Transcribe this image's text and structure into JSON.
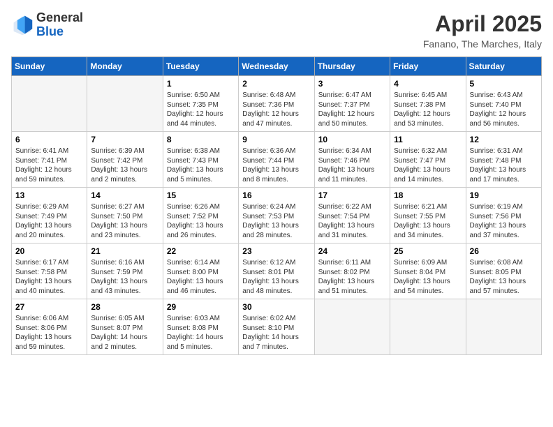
{
  "header": {
    "logo_line1": "General",
    "logo_line2": "Blue",
    "title": "April 2025",
    "subtitle": "Fanano, The Marches, Italy"
  },
  "days_of_week": [
    "Sunday",
    "Monday",
    "Tuesday",
    "Wednesday",
    "Thursday",
    "Friday",
    "Saturday"
  ],
  "weeks": [
    [
      {
        "num": "",
        "sunrise": "",
        "sunset": "",
        "daylight": ""
      },
      {
        "num": "",
        "sunrise": "",
        "sunset": "",
        "daylight": ""
      },
      {
        "num": "1",
        "sunrise": "Sunrise: 6:50 AM",
        "sunset": "Sunset: 7:35 PM",
        "daylight": "Daylight: 12 hours and 44 minutes."
      },
      {
        "num": "2",
        "sunrise": "Sunrise: 6:48 AM",
        "sunset": "Sunset: 7:36 PM",
        "daylight": "Daylight: 12 hours and 47 minutes."
      },
      {
        "num": "3",
        "sunrise": "Sunrise: 6:47 AM",
        "sunset": "Sunset: 7:37 PM",
        "daylight": "Daylight: 12 hours and 50 minutes."
      },
      {
        "num": "4",
        "sunrise": "Sunrise: 6:45 AM",
        "sunset": "Sunset: 7:38 PM",
        "daylight": "Daylight: 12 hours and 53 minutes."
      },
      {
        "num": "5",
        "sunrise": "Sunrise: 6:43 AM",
        "sunset": "Sunset: 7:40 PM",
        "daylight": "Daylight: 12 hours and 56 minutes."
      }
    ],
    [
      {
        "num": "6",
        "sunrise": "Sunrise: 6:41 AM",
        "sunset": "Sunset: 7:41 PM",
        "daylight": "Daylight: 12 hours and 59 minutes."
      },
      {
        "num": "7",
        "sunrise": "Sunrise: 6:39 AM",
        "sunset": "Sunset: 7:42 PM",
        "daylight": "Daylight: 13 hours and 2 minutes."
      },
      {
        "num": "8",
        "sunrise": "Sunrise: 6:38 AM",
        "sunset": "Sunset: 7:43 PM",
        "daylight": "Daylight: 13 hours and 5 minutes."
      },
      {
        "num": "9",
        "sunrise": "Sunrise: 6:36 AM",
        "sunset": "Sunset: 7:44 PM",
        "daylight": "Daylight: 13 hours and 8 minutes."
      },
      {
        "num": "10",
        "sunrise": "Sunrise: 6:34 AM",
        "sunset": "Sunset: 7:46 PM",
        "daylight": "Daylight: 13 hours and 11 minutes."
      },
      {
        "num": "11",
        "sunrise": "Sunrise: 6:32 AM",
        "sunset": "Sunset: 7:47 PM",
        "daylight": "Daylight: 13 hours and 14 minutes."
      },
      {
        "num": "12",
        "sunrise": "Sunrise: 6:31 AM",
        "sunset": "Sunset: 7:48 PM",
        "daylight": "Daylight: 13 hours and 17 minutes."
      }
    ],
    [
      {
        "num": "13",
        "sunrise": "Sunrise: 6:29 AM",
        "sunset": "Sunset: 7:49 PM",
        "daylight": "Daylight: 13 hours and 20 minutes."
      },
      {
        "num": "14",
        "sunrise": "Sunrise: 6:27 AM",
        "sunset": "Sunset: 7:50 PM",
        "daylight": "Daylight: 13 hours and 23 minutes."
      },
      {
        "num": "15",
        "sunrise": "Sunrise: 6:26 AM",
        "sunset": "Sunset: 7:52 PM",
        "daylight": "Daylight: 13 hours and 26 minutes."
      },
      {
        "num": "16",
        "sunrise": "Sunrise: 6:24 AM",
        "sunset": "Sunset: 7:53 PM",
        "daylight": "Daylight: 13 hours and 28 minutes."
      },
      {
        "num": "17",
        "sunrise": "Sunrise: 6:22 AM",
        "sunset": "Sunset: 7:54 PM",
        "daylight": "Daylight: 13 hours and 31 minutes."
      },
      {
        "num": "18",
        "sunrise": "Sunrise: 6:21 AM",
        "sunset": "Sunset: 7:55 PM",
        "daylight": "Daylight: 13 hours and 34 minutes."
      },
      {
        "num": "19",
        "sunrise": "Sunrise: 6:19 AM",
        "sunset": "Sunset: 7:56 PM",
        "daylight": "Daylight: 13 hours and 37 minutes."
      }
    ],
    [
      {
        "num": "20",
        "sunrise": "Sunrise: 6:17 AM",
        "sunset": "Sunset: 7:58 PM",
        "daylight": "Daylight: 13 hours and 40 minutes."
      },
      {
        "num": "21",
        "sunrise": "Sunrise: 6:16 AM",
        "sunset": "Sunset: 7:59 PM",
        "daylight": "Daylight: 13 hours and 43 minutes."
      },
      {
        "num": "22",
        "sunrise": "Sunrise: 6:14 AM",
        "sunset": "Sunset: 8:00 PM",
        "daylight": "Daylight: 13 hours and 46 minutes."
      },
      {
        "num": "23",
        "sunrise": "Sunrise: 6:12 AM",
        "sunset": "Sunset: 8:01 PM",
        "daylight": "Daylight: 13 hours and 48 minutes."
      },
      {
        "num": "24",
        "sunrise": "Sunrise: 6:11 AM",
        "sunset": "Sunset: 8:02 PM",
        "daylight": "Daylight: 13 hours and 51 minutes."
      },
      {
        "num": "25",
        "sunrise": "Sunrise: 6:09 AM",
        "sunset": "Sunset: 8:04 PM",
        "daylight": "Daylight: 13 hours and 54 minutes."
      },
      {
        "num": "26",
        "sunrise": "Sunrise: 6:08 AM",
        "sunset": "Sunset: 8:05 PM",
        "daylight": "Daylight: 13 hours and 57 minutes."
      }
    ],
    [
      {
        "num": "27",
        "sunrise": "Sunrise: 6:06 AM",
        "sunset": "Sunset: 8:06 PM",
        "daylight": "Daylight: 13 hours and 59 minutes."
      },
      {
        "num": "28",
        "sunrise": "Sunrise: 6:05 AM",
        "sunset": "Sunset: 8:07 PM",
        "daylight": "Daylight: 14 hours and 2 minutes."
      },
      {
        "num": "29",
        "sunrise": "Sunrise: 6:03 AM",
        "sunset": "Sunset: 8:08 PM",
        "daylight": "Daylight: 14 hours and 5 minutes."
      },
      {
        "num": "30",
        "sunrise": "Sunrise: 6:02 AM",
        "sunset": "Sunset: 8:10 PM",
        "daylight": "Daylight: 14 hours and 7 minutes."
      },
      {
        "num": "",
        "sunrise": "",
        "sunset": "",
        "daylight": ""
      },
      {
        "num": "",
        "sunrise": "",
        "sunset": "",
        "daylight": ""
      },
      {
        "num": "",
        "sunrise": "",
        "sunset": "",
        "daylight": ""
      }
    ]
  ]
}
